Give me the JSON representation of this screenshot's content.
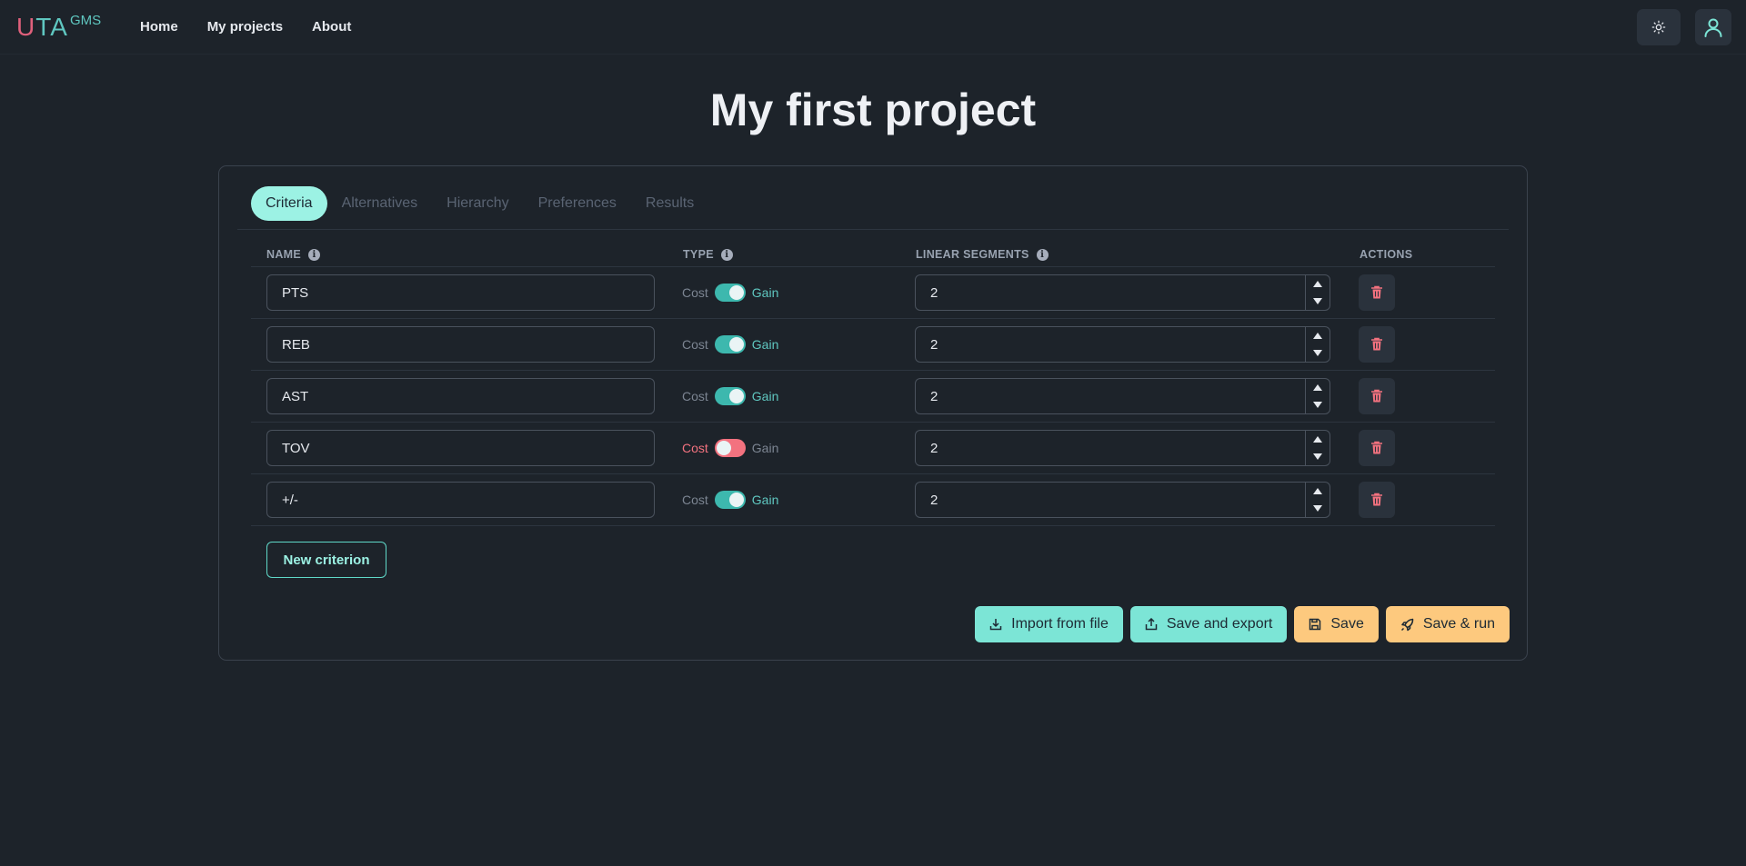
{
  "nav": {
    "logo": {
      "u": "U",
      "ta": "TA",
      "sup": "GMS"
    },
    "links": [
      "Home",
      "My projects",
      "About"
    ],
    "theme_icon": "sun-icon",
    "user_icon": "user-icon"
  },
  "page": {
    "title": "My first project"
  },
  "tabs": [
    "Criteria",
    "Alternatives",
    "Hierarchy",
    "Preferences",
    "Results"
  ],
  "table": {
    "headers": {
      "name": "NAME",
      "type": "TYPE",
      "segments": "LINEAR SEGMENTS",
      "actions": "ACTIONS"
    },
    "type_labels": {
      "cost": "Cost",
      "gain": "Gain"
    },
    "rows": [
      {
        "name": "PTS",
        "type": "gain",
        "segments": "2"
      },
      {
        "name": "REB",
        "type": "gain",
        "segments": "2"
      },
      {
        "name": "AST",
        "type": "gain",
        "segments": "2"
      },
      {
        "name": "TOV",
        "type": "cost",
        "segments": "2"
      },
      {
        "name": "+/-",
        "type": "gain",
        "segments": "2"
      }
    ]
  },
  "buttons": {
    "new_criterion": "New criterion",
    "import": "Import from file",
    "export": "Save and export",
    "save": "Save",
    "save_run": "Save & run"
  },
  "colors": {
    "accent_teal": "#7ce5d6",
    "accent_orange": "#fdc97e",
    "danger": "#f3727f",
    "background": "#1d232a"
  }
}
